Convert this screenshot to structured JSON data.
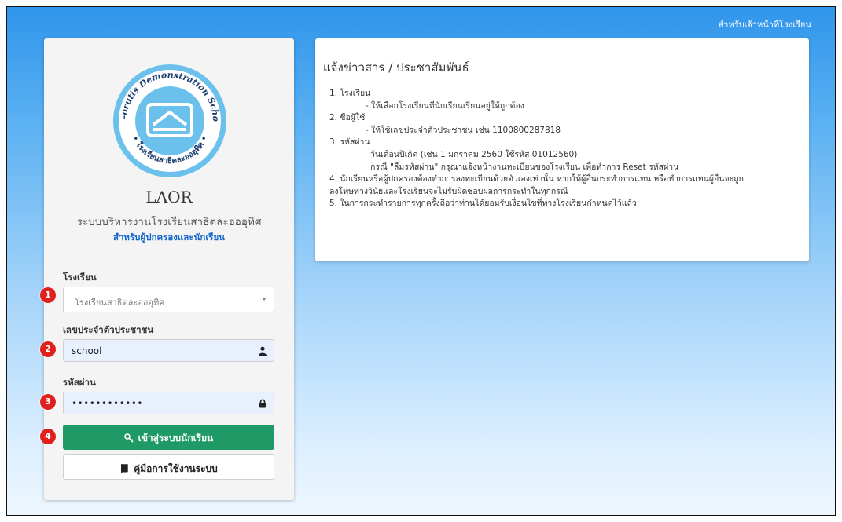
{
  "header": {
    "staff_link": "สำหรับเจ้าหน้าที่โรงเรียน"
  },
  "login": {
    "app_name": "LAOR",
    "app_subtitle": "ระบบบริหารงานโรงเรียนสาธิตละอออุทิศ",
    "audience": "สำหรับผู้ปกครองและนักเรียน",
    "school_label": "โรงเรียน",
    "school_value": "โรงเรียนสาธิตละอออุทิศ",
    "id_label": "เลขประจำตัวประชาชน",
    "id_value": "school",
    "password_label": "รหัสผ่าน",
    "password_value": "••••••••••••",
    "login_button": "เข้าสู่ระบบนักเรียน",
    "manual_button": "คู่มือการใช้งานระบบ"
  },
  "logo": {
    "alt_text": "La-orutis Demonstration School / โรงเรียนสาธิตละอออุทิศ"
  },
  "badges": [
    "1",
    "2",
    "3",
    "4"
  ],
  "news": {
    "title": "แจ้งข่าวสาร / ประชาสัมพันธ์",
    "lines": [
      "1. โรงเรียน",
      "- ให้เลือกโรงเรียนที่นักเรียนเรียนอยู่ให้ถูกต้อง",
      "2. ชื่อผู้ใช้",
      "- ให้ใช้เลขประจำตัวประชาชน เช่น 1100800287818",
      "3. รหัสผ่าน",
      "วันเดือนปีเกิด (เช่น 1 มกราคม 2560 ใช้รหัส 01012560)",
      "กรณี \"ลืมรหัสผ่าน\" กรุณาแจ้งหน้างานทะเบียนของโรงเรียน เพื่อทำการ Reset รหัสผ่าน",
      "4. นักเรียนหรือผู้ปกครองต้องทำการลงทะเบียนด้วยตัวเองเท่านั้น หากให้ผู้อื่นกระทำการแทน หรือทำการแทนผู้อื่นจะถูก",
      "ลงโทษทางวินัยและโรงเรียนจะไม่รับผิดชอบผลการกระทำในทุกกรณี",
      "5. ในการกระทำรายการทุกครั้งถือว่าท่านได้ยอมรับเงื่อนไขที่ทางโรงเรียนกำหนดไว้แล้ว"
    ]
  },
  "colors": {
    "primary_button": "#1f9a67",
    "badge": "#e0211b",
    "audience_text": "#1366c9",
    "background_top": "#2f95eb"
  },
  "icons": {
    "select_caret": "chevron-down-icon",
    "id_field": "user-icon",
    "password_field": "lock-icon",
    "login_button": "key-icon",
    "manual_button": "book-icon"
  }
}
